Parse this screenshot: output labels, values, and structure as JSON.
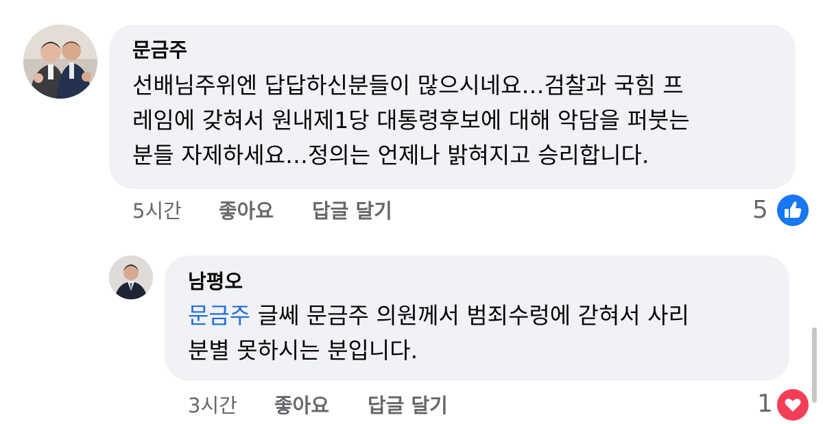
{
  "comments": [
    {
      "author": "문금주",
      "lines": [
        "선배님주위엔 답답하신분들이 많으시네요…검찰과 국힘 프",
        "레임에 갖혀서 원내제1당 대통령후보에 대해 악담을 퍼붓는",
        "분들 자제하세요…정의는 언제나 밝혀지고 승리합니다."
      ],
      "time": "5시간",
      "like_label": "좋아요",
      "reply_label": "답글 달기",
      "reaction_count": "5",
      "reaction_icon": "thumbs-up-icon",
      "reaction_color": "#1877f2"
    },
    {
      "author": "남평오",
      "mention": "문금주",
      "line1_rest": " 글쎄 문금주 의원께서 범죄수렁에 갇혀서 사리",
      "line2": "분별 못하시는 분입니다.",
      "time": "3시간",
      "like_label": "좋아요",
      "reply_label": "답글 달기",
      "reaction_count": "1",
      "reaction_icon": "heart-icon",
      "reaction_color": "#f33e58"
    }
  ]
}
